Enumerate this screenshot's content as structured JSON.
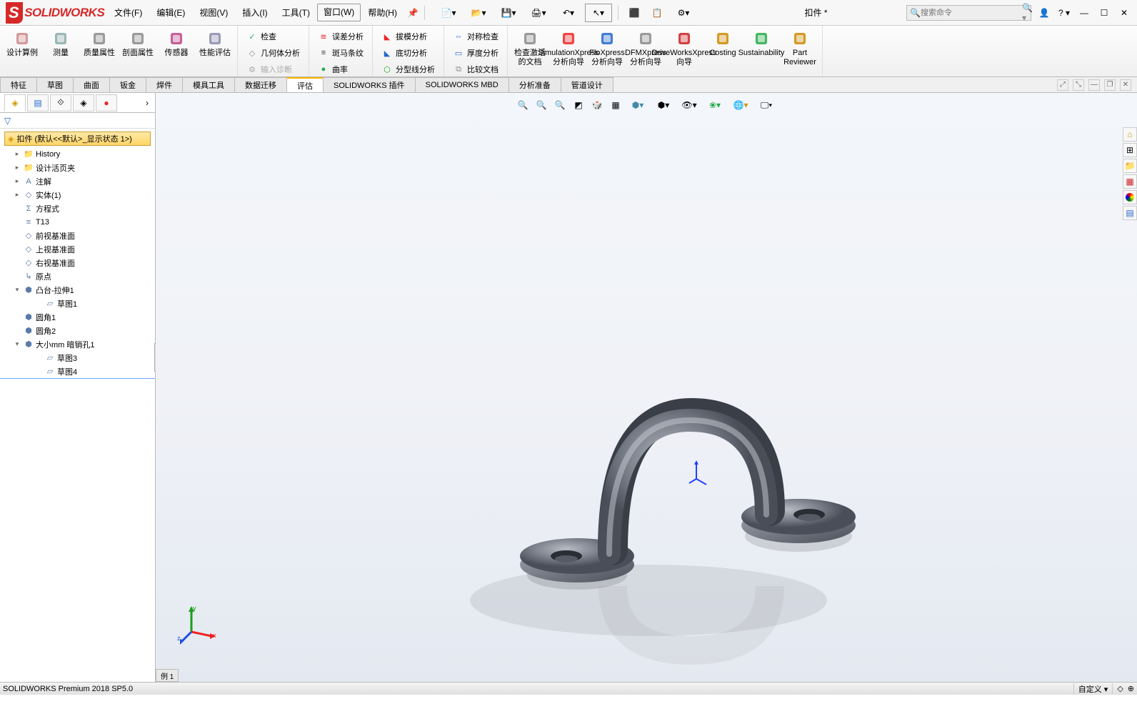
{
  "app": {
    "logo_letter": "S",
    "logo_rest": "SOLIDWORKS"
  },
  "menu": {
    "items": [
      "文件(F)",
      "编辑(E)",
      "视图(V)",
      "插入(I)",
      "工具(T)",
      "窗口(W)",
      "帮助(H)"
    ],
    "boxed_index": 5
  },
  "doc_title": "扣件 *",
  "search_placeholder": "搜索命令",
  "ribbon": {
    "big": [
      {
        "label": "设计算例",
        "icon_color": "#c88"
      },
      {
        "label": "测量",
        "icon_color": "#8aa"
      },
      {
        "label": "质量属性",
        "icon_color": "#888"
      },
      {
        "label": "剖面属性",
        "icon_color": "#888"
      },
      {
        "label": "传感器",
        "icon_color": "#b48"
      },
      {
        "label": "性能评估",
        "icon_color": "#88a"
      }
    ],
    "small1": [
      {
        "label": "检查",
        "icon": "✓",
        "color": "#2a8"
      },
      {
        "label": "几何体分析",
        "icon": "◇",
        "color": "#888"
      },
      {
        "label": "输入诊断",
        "icon": "⚙",
        "color": "#aaa",
        "disabled": true
      }
    ],
    "small2": [
      {
        "label": "误差分析",
        "icon": "≋",
        "color": "#e22"
      },
      {
        "label": "斑马条纹",
        "icon": "≡",
        "color": "#333"
      },
      {
        "label": "曲率",
        "icon": "●",
        "color": "#2a4"
      }
    ],
    "small3": [
      {
        "label": "拔模分析",
        "icon": "◣",
        "color": "#e22"
      },
      {
        "label": "底切分析",
        "icon": "◣",
        "color": "#26c"
      },
      {
        "label": "分型线分析",
        "icon": "⬡",
        "color": "#2a2"
      }
    ],
    "small4": [
      {
        "label": "对称检查",
        "icon": "⇔",
        "color": "#26c"
      },
      {
        "label": "厚度分析",
        "icon": "▭",
        "color": "#26c"
      },
      {
        "label": "比较文档",
        "icon": "⧉",
        "color": "#888"
      }
    ],
    "big2": [
      {
        "label": "检查激活的文档",
        "icon_color": "#888"
      },
      {
        "label": "SimulationXpress 分析向导",
        "icon_color": "#e22"
      },
      {
        "label": "FloXpress 分析向导",
        "icon_color": "#26c"
      },
      {
        "label": "DFMXpress 分析向导",
        "icon_color": "#888"
      },
      {
        "label": "DriveWorksXpress 向导",
        "icon_color": "#c22"
      },
      {
        "label": "Costing",
        "icon_color": "#c80"
      },
      {
        "label": "Sustainability",
        "icon_color": "#2a4"
      },
      {
        "label": "Part Reviewer",
        "icon_color": "#c80"
      }
    ]
  },
  "tabs": {
    "items": [
      "特征",
      "草图",
      "曲面",
      "钣金",
      "焊件",
      "模具工具",
      "数据迁移",
      "评估",
      "SOLIDWORKS 插件",
      "SOLIDWORKS MBD",
      "分析准备",
      "管道设计"
    ],
    "active_index": 7
  },
  "tree": {
    "root": "扣件  (默认<<默认>_显示状态 1>)",
    "items": [
      {
        "level": 1,
        "toggle": "▸",
        "icon": "📁",
        "label": "History"
      },
      {
        "level": 1,
        "toggle": "▸",
        "icon": "📁",
        "label": "设计活页夹"
      },
      {
        "level": 1,
        "toggle": "▸",
        "icon": "A",
        "label": "注解"
      },
      {
        "level": 1,
        "toggle": "▸",
        "icon": "◇",
        "label": "实体(1)"
      },
      {
        "level": 1,
        "toggle": "",
        "icon": "Σ",
        "label": "方程式"
      },
      {
        "level": 1,
        "toggle": "",
        "icon": "≡",
        "label": "T13"
      },
      {
        "level": 1,
        "toggle": "",
        "icon": "◇",
        "label": "前视基准面"
      },
      {
        "level": 1,
        "toggle": "",
        "icon": "◇",
        "label": "上视基准面"
      },
      {
        "level": 1,
        "toggle": "",
        "icon": "◇",
        "label": "右视基准面"
      },
      {
        "level": 1,
        "toggle": "",
        "icon": "↳",
        "label": "原点"
      },
      {
        "level": 1,
        "toggle": "▾",
        "icon": "⬢",
        "label": "凸台-拉伸1"
      },
      {
        "level": 2,
        "toggle": "",
        "icon": "▱",
        "label": "草图1"
      },
      {
        "level": 1,
        "toggle": "",
        "icon": "⬢",
        "label": "圆角1"
      },
      {
        "level": 1,
        "toggle": "",
        "icon": "⬢",
        "label": "圆角2"
      },
      {
        "level": 1,
        "toggle": "▾",
        "icon": "⬢",
        "label": "大小mm 暗销孔1"
      },
      {
        "level": 2,
        "toggle": "",
        "icon": "▱",
        "label": "草图3"
      },
      {
        "level": 2,
        "toggle": "",
        "icon": "▱",
        "label": "草图4"
      }
    ]
  },
  "viewport_tab": "例 1",
  "status": {
    "left": "SOLIDWORKS Premium 2018 SP5.0",
    "right_label": "自定义"
  },
  "triad_axes": {
    "x": "x",
    "y": "y",
    "z": "z"
  }
}
